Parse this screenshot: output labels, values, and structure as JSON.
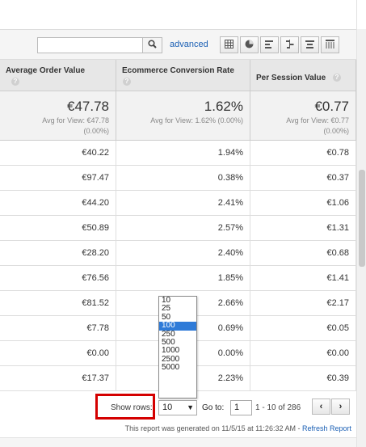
{
  "toolbar": {
    "search_placeholder": "",
    "advanced_label": "advanced",
    "view_icons": [
      "table-view-icon",
      "pie-view-icon",
      "performance-view-icon",
      "comparison-view-icon",
      "term-cloud-view-icon",
      "pivot-view-icon"
    ]
  },
  "columns": [
    {
      "label": "Average Order Value"
    },
    {
      "label": "Ecommerce Conversion Rate"
    },
    {
      "label": "Per Session Value"
    }
  ],
  "summary": [
    {
      "big": "€47.78",
      "avg": "Avg for View: €47.78",
      "pct": "(0.00%)"
    },
    {
      "big": "1.62%",
      "avg": "Avg for View: 1.62% (0.00%)",
      "pct": ""
    },
    {
      "big": "€0.77",
      "avg": "Avg for View: €0.77",
      "pct": "(0.00%)"
    }
  ],
  "rows": [
    [
      "€40.22",
      "1.94%",
      "€0.78"
    ],
    [
      "€97.47",
      "0.38%",
      "€0.37"
    ],
    [
      "€44.20",
      "2.41%",
      "€1.06"
    ],
    [
      "€50.89",
      "2.57%",
      "€1.31"
    ],
    [
      "€28.20",
      "2.40%",
      "€0.68"
    ],
    [
      "€76.56",
      "1.85%",
      "€1.41"
    ],
    [
      "€81.52",
      "2.66%",
      "€2.17"
    ],
    [
      "€7.78",
      "0.69%",
      "€0.05"
    ],
    [
      "€0.00",
      "0.00%",
      "€0.00"
    ],
    [
      "€17.37",
      "2.23%",
      "€0.39"
    ]
  ],
  "pager": {
    "show_rows_label": "Show rows:",
    "rows_selected": "10",
    "goto_label": "Go to:",
    "goto_value": "1",
    "range": "1 - 10 of 286",
    "prev": "‹",
    "next": "›"
  },
  "dropdown_options": [
    "10",
    "25",
    "50",
    "100",
    "250",
    "500",
    "1000",
    "2500",
    "5000"
  ],
  "dropdown_highlighted": "100",
  "footer": {
    "text": "This report was generated on 11/5/15 at 11:26:32 AM - ",
    "link": "Refresh Report"
  },
  "colors": {
    "accent": "#1a5fb4",
    "highlight": "#d40000",
    "selected": "#2f7bd8"
  }
}
